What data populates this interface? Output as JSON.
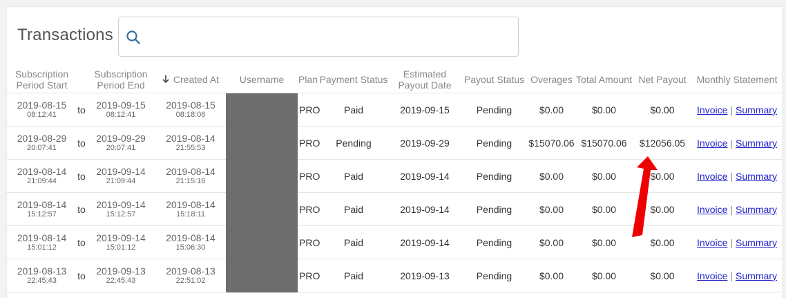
{
  "title": "Transactions",
  "search": {
    "value": "",
    "placeholder": ""
  },
  "columns": [
    "Subscription Period Start",
    "",
    "Subscription Period End",
    "Created At",
    "Username",
    "Plan",
    "Payment Status",
    "Estimated Payout Date",
    "Payout Status",
    "Overages",
    "Total Amount",
    "Net Payout",
    "Monthly Statement"
  ],
  "sort": {
    "column": "Created At",
    "direction": "descending",
    "icon": "arrow-down-icon"
  },
  "rows": [
    {
      "start_date": "2019-08-15",
      "start_time": "08:12:41",
      "to": "to",
      "end_date": "2019-09-15",
      "end_time": "08:12:41",
      "created_date": "2019-08-15",
      "created_time": "08:18:06",
      "username": "",
      "plan": "PRO",
      "payment_status": "Paid",
      "payout_date": "2019-09-15",
      "payout_status": "Pending",
      "overages": "$0.00",
      "total": "$0.00",
      "net": "$0.00",
      "invoice": "Invoice",
      "summary": "Summary"
    },
    {
      "start_date": "2019-08-29",
      "start_time": "20:07:41",
      "to": "to",
      "end_date": "2019-09-29",
      "end_time": "20:07:41",
      "created_date": "2019-08-14",
      "created_time": "21:55:53",
      "username": "",
      "plan": "PRO",
      "payment_status": "Pending",
      "payout_date": "2019-09-29",
      "payout_status": "Pending",
      "overages": "$15070.06",
      "total": "$15070.06",
      "net": "$12056.05",
      "invoice": "Invoice",
      "summary": "Summary"
    },
    {
      "start_date": "2019-08-14",
      "start_time": "21:09:44",
      "to": "to",
      "end_date": "2019-09-14",
      "end_time": "21:09:44",
      "created_date": "2019-08-14",
      "created_time": "21:15:16",
      "username": "",
      "plan": "PRO",
      "payment_status": "Paid",
      "payout_date": "2019-09-14",
      "payout_status": "Pending",
      "overages": "$0.00",
      "total": "$0.00",
      "net": "$0.00",
      "invoice": "Invoice",
      "summary": "Summary"
    },
    {
      "start_date": "2019-08-14",
      "start_time": "15:12:57",
      "to": "to",
      "end_date": "2019-09-14",
      "end_time": "15:12:57",
      "created_date": "2019-08-14",
      "created_time": "15:18:11",
      "username": "",
      "plan": "PRO",
      "payment_status": "Paid",
      "payout_date": "2019-09-14",
      "payout_status": "Pending",
      "overages": "$0.00",
      "total": "$0.00",
      "net": "$0.00",
      "invoice": "Invoice",
      "summary": "Summary"
    },
    {
      "start_date": "2019-08-14",
      "start_time": "15:01:12",
      "to": "to",
      "end_date": "2019-09-14",
      "end_time": "15:01:12",
      "created_date": "2019-08-14",
      "created_time": "15:06:30",
      "username": "",
      "plan": "PRO",
      "payment_status": "Paid",
      "payout_date": "2019-09-14",
      "payout_status": "Pending",
      "overages": "$0.00",
      "total": "$0.00",
      "net": "$0.00",
      "invoice": "Invoice",
      "summary": "Summary"
    },
    {
      "start_date": "2019-08-13",
      "start_time": "22:45:43",
      "to": "to",
      "end_date": "2019-09-13",
      "end_time": "22:45:43",
      "created_date": "2019-08-13",
      "created_time": "22:51:02",
      "username": "",
      "plan": "PRO",
      "payment_status": "Paid",
      "payout_date": "2019-09-13",
      "payout_status": "Pending",
      "overages": "$0.00",
      "total": "$0.00",
      "net": "$0.00",
      "invoice": "Invoice",
      "summary": "Summary"
    }
  ],
  "link_separator": "|",
  "colors": {
    "link": "#2222cc",
    "redacted": "#6d6d6d",
    "annotation_arrow": "#ee0000",
    "header_text": "#888888"
  }
}
